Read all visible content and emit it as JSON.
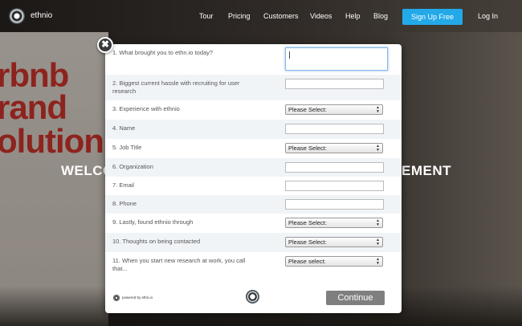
{
  "brand": "ethnio",
  "nav": {
    "links": [
      "Tour",
      "Pricing",
      "Customers",
      "Videos",
      "Help",
      "Blog"
    ],
    "signup": "Sign Up Free",
    "login": "Log In"
  },
  "hero": {
    "welcome_left": "WELCO",
    "welcome_right": "EMENT",
    "bg_lines": [
      "rbnb",
      "rand",
      "olution"
    ]
  },
  "form": {
    "questions": [
      {
        "label": "1. What brought you to ethn.io today?",
        "type": "textarea"
      },
      {
        "label": "2. Biggest current hassle with recruiting for user research",
        "type": "input"
      },
      {
        "label": "3. Experience with ethnio",
        "type": "select",
        "value": "Please Select:"
      },
      {
        "label": "4. Name",
        "type": "input"
      },
      {
        "label": "5. Job Title",
        "type": "select",
        "value": "Please Select:"
      },
      {
        "label": "6. Organization",
        "type": "input"
      },
      {
        "label": "7. Email",
        "type": "input"
      },
      {
        "label": "8. Phone",
        "type": "input"
      },
      {
        "label": "9. Lastly, found ethnio through",
        "type": "select",
        "value": "Please Select:"
      },
      {
        "label": "10. Thoughts on being contacted",
        "type": "select",
        "value": "Please Select:"
      },
      {
        "label": "11. When you start new research at work, you call that...",
        "type": "select",
        "value": "Please select:"
      }
    ],
    "powered_by": "powered by ethn.io",
    "continue": "Continue",
    "close_icon": "close-icon"
  }
}
